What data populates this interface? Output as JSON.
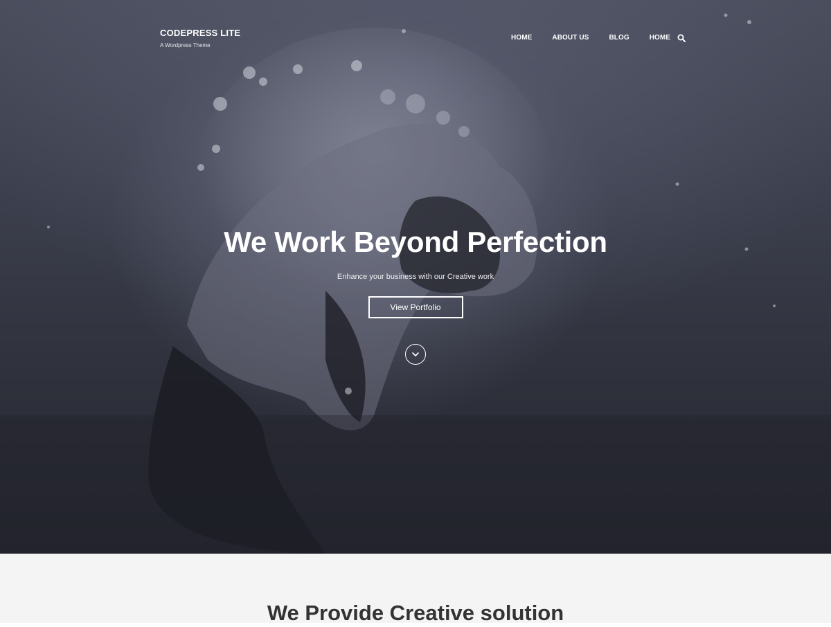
{
  "site": {
    "title": "CODEPRESS LITE",
    "tagline": "A Wordpress Theme"
  },
  "nav": {
    "items": [
      {
        "label": "HOME"
      },
      {
        "label": "ABOUT US"
      },
      {
        "label": "BLOG"
      },
      {
        "label": "HOME"
      }
    ],
    "search_icon": "search-icon"
  },
  "hero": {
    "title": "We Work Beyond Perfection",
    "subtitle": "Enhance your business with our Creative work",
    "button_label": "View Portfolio",
    "scroll_icon": "chevron-down-icon"
  },
  "section": {
    "title": "We Provide Creative solution"
  },
  "colors": {
    "hero_overlay": "#3c3f4d",
    "text_light": "#ffffff",
    "section_bg": "#f4f4f5",
    "section_title": "#333333"
  }
}
